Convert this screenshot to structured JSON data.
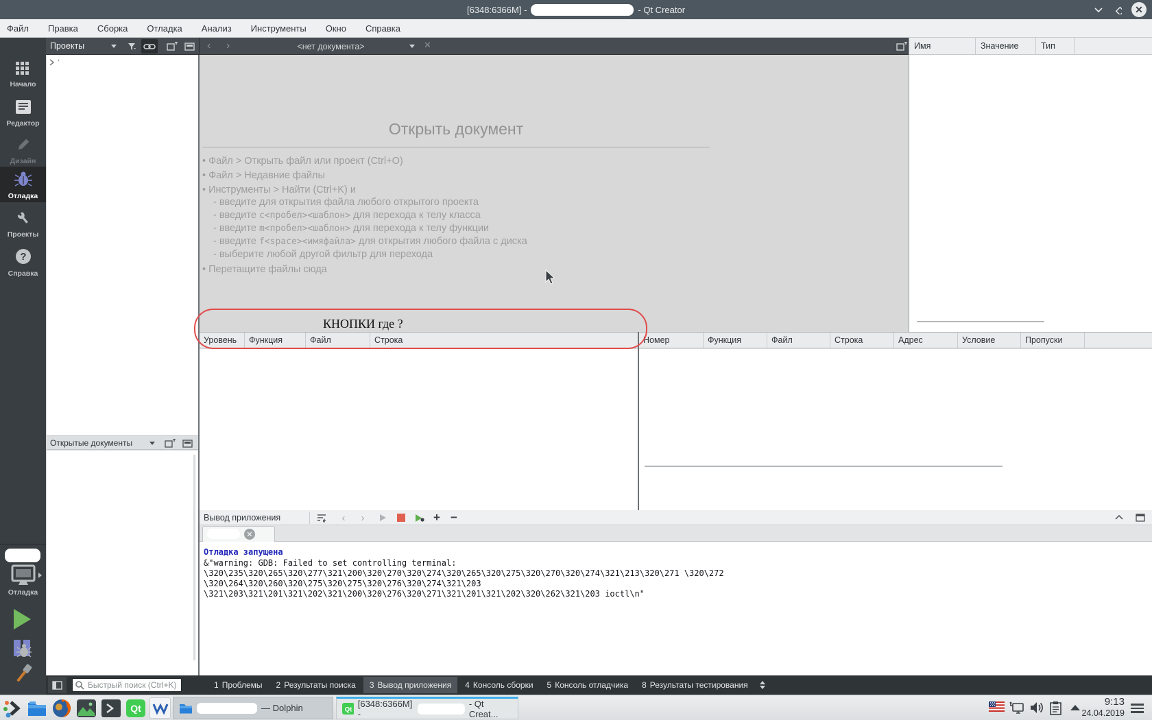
{
  "colors": {
    "kde_accent": "#3daee9",
    "annotation_red": "#e14b4b",
    "run_green": "#73ba5e",
    "stop_red": "#e0614f",
    "debug_blue": "#7d85cc",
    "output_info_blue": "#2228b9"
  },
  "titlebar": {
    "title_prefix": "[6348:6366M] -",
    "title_suffix": "- Qt Creator"
  },
  "menu": {
    "items": [
      "Файл",
      "Правка",
      "Сборка",
      "Отладка",
      "Анализ",
      "Инструменты",
      "Окно",
      "Справка"
    ]
  },
  "mode_sidebar": {
    "items": [
      {
        "label": "Начало"
      },
      {
        "label": "Редактор"
      },
      {
        "label": "Дизайн"
      },
      {
        "label": "Отладка"
      },
      {
        "label": "Проекты"
      },
      {
        "label": "Справка"
      }
    ],
    "target_label": "Отладка"
  },
  "projects_toolbar": {
    "combo_label": "Проекты"
  },
  "doc_toolbar": {
    "document_selector": "<нет документа>"
  },
  "right_panel": {
    "columns": [
      "Имя",
      "Значение",
      "Тип"
    ]
  },
  "stack_table": {
    "columns": [
      "Уровень",
      "Функция",
      "Файл",
      "Строка"
    ]
  },
  "breakpoints_table": {
    "columns": [
      "Номер",
      "Функция",
      "Файл",
      "Строка",
      "Адрес",
      "Условие",
      "Пропуски"
    ]
  },
  "open_docs": {
    "header": "Открытые документы"
  },
  "welcome": {
    "title": "Открыть документ",
    "items": [
      {
        "text": "• Файл > Открыть файл или проект (Ctrl+O)"
      },
      {
        "text": "• Файл > Недавние файлы"
      },
      {
        "text": "• Инструменты > Найти (Ctrl+K) и"
      },
      {
        "pre": "- введите для открытия файла любого открытого проекта"
      },
      {
        "pre": "- введите ",
        "code": "c<пробел><шаблон>",
        "post": " для перехода к телу класса"
      },
      {
        "pre": "- введите ",
        "code": "m<пробел><шаблон>",
        "post": " для перехода к телу функции"
      },
      {
        "pre": "- введите ",
        "code": "f<space><имяфайла>",
        "post": " для открытия любого файла с диска"
      },
      {
        "pre": "- выберите любой другой фильтр для перехода"
      },
      {
        "text": "• Перетащите файлы сюда"
      }
    ]
  },
  "annotation": {
    "text": "КНОПКИ где ?"
  },
  "output_pane": {
    "title": "Вывод приложения",
    "info_line": "Отладка запущена",
    "warning_line": "&\"warning: GDB: Failed to set controlling terminal: \\320\\235\\320\\265\\320\\277\\321\\200\\320\\270\\320\\274\\320\\265\\320\\275\\320\\270\\320\\274\\321\\213\\320\\271 \\320\\272 \\320\\264\\320\\260\\320\\275\\320\\275\\320\\276\\320\\274\\321\\203 \\321\\203\\321\\201\\321\\202\\321\\200\\320\\276\\320\\271\\321\\201\\321\\202\\320\\262\\321\\203 ioctl\\n\"",
    "tab_close": "✕"
  },
  "bottom_bar": {
    "search_placeholder": "Быстрый поиск (Ctrl+K)",
    "panes": [
      {
        "n": "1",
        "label": "Проблемы"
      },
      {
        "n": "2",
        "label": "Результаты поиска"
      },
      {
        "n": "3",
        "label": "Вывод приложения"
      },
      {
        "n": "4",
        "label": "Консоль сборки"
      },
      {
        "n": "5",
        "label": "Консоль отладчика"
      },
      {
        "n": "8",
        "label": "Результаты тестирования"
      }
    ]
  },
  "taskbar": {
    "dolphin_task_suffix": "— Dolphin",
    "qt_task_prefix": "[6348:6366M] -",
    "qt_task_suffix": "- Qt Creat...",
    "clock_time": "9:13",
    "clock_date": "24.04.2019"
  }
}
